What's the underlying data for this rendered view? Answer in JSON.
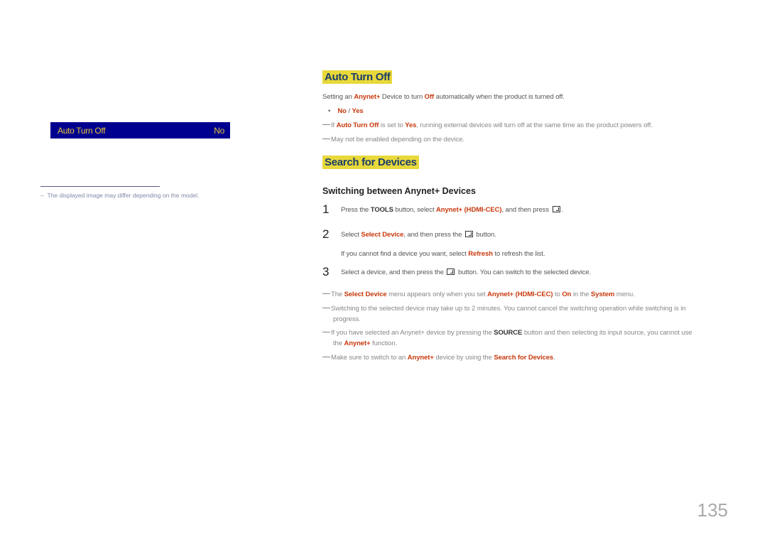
{
  "menu_preview": {
    "label": "Auto Turn Off",
    "value": "No"
  },
  "footnote": {
    "dash": "–",
    "text": "The displayed image may differ depending on the model."
  },
  "section1": {
    "title": "Auto Turn Off",
    "desc": {
      "p1": "Setting an ",
      "anynet": "Anynet+",
      "p2": " Device to turn ",
      "off": "Off",
      "p3": " automatically when the product is turned off."
    },
    "bullet": {
      "mark": "•",
      "no": "No",
      "sep": " / ",
      "yes": "Yes"
    },
    "notes": [
      {
        "p1": "If ",
        "b1": "Auto Turn Off",
        "p2": " is set to ",
        "b2": "Yes",
        "p3": ", running external devices will turn off at the same time as the product powers off."
      },
      {
        "text": "May not be enabled depending on the device."
      }
    ]
  },
  "section2": {
    "title": "Search for Devices",
    "subheading": "Switching between Anynet+ Devices",
    "steps": [
      {
        "num": "1",
        "p1": "Press the ",
        "b1": "TOOLS",
        "p2": " button, select ",
        "h1": "Anynet+ (HDMI-CEC)",
        "p3": ", and then press ",
        "p4": "."
      },
      {
        "num": "2",
        "p1": "Select ",
        "h1": "Select Device",
        "p2": ", and then press the ",
        "p3": " button.",
        "extra": {
          "p1": "If you cannot find a device you want, select ",
          "h1": "Refresh",
          "p2": " to refresh the list."
        }
      },
      {
        "num": "3",
        "p1": "Select a device, and then press the ",
        "p2": " button. You can switch to the selected device."
      }
    ],
    "notes": [
      {
        "p1": "The ",
        "h1": "Select Device",
        "p2": " menu appears only when you set ",
        "h2": "Anynet+ (HDMI-CEC)",
        "p3": " to ",
        "h3": "On",
        "p4": " in the ",
        "h4": "System",
        "p5": " menu."
      },
      {
        "line1": "Switching to the selected device may take up to 2 minutes. You cannot cancel the switching operation while switching is in",
        "line2": "progress."
      },
      {
        "p1": "If you have selected an Anynet+ device by pressing the ",
        "b1": "SOURCE",
        "p2": " button and then selecting its input source, you cannot use",
        "p3": "the ",
        "h1": "Anynet+",
        "p4": " function."
      },
      {
        "p1": "Make sure to switch to an ",
        "h1": "Anynet+",
        "p2": " device by using the ",
        "h2": "Search for Devices",
        "p3": "."
      }
    ]
  },
  "page_number": "135"
}
